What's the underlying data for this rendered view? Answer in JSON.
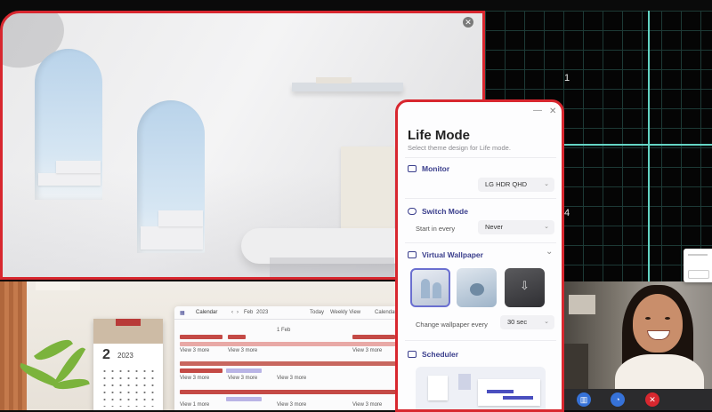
{
  "colors": {
    "accent_red": "#d8272f",
    "panel_accent": "#3a3e8c",
    "grid_line": "#63d4c4"
  },
  "grid": {
    "label_1": "1",
    "label_4": "4"
  },
  "panel": {
    "title": "Life Mode",
    "subtitle": "Select theme design for Life mode.",
    "monitor": {
      "label": "Monitor",
      "icon": "monitor-icon",
      "value": "LG HDR QHD"
    },
    "switch_mode": {
      "label": "Switch Mode",
      "icon": "switch-icon",
      "field_label": "Start in every",
      "value": "Never"
    },
    "virtual_wallpaper": {
      "label": "Virtual Wallpaper",
      "icon": "wallpaper-icon",
      "change_label": "Change wallpaper every",
      "interval": "30 sec"
    },
    "scheduler": {
      "label": "Scheduler",
      "icon": "calendar-icon"
    },
    "minimize_glyph": "—",
    "close_glyph": "✕",
    "collapse_glyph": "⌄"
  },
  "desk_calendar": {
    "day": "2",
    "year": "2023"
  },
  "calendar_app": {
    "title": "Calendar",
    "month": "Feb",
    "year": "2023",
    "view": "Weekly View",
    "today": "Today",
    "date_label": "1 Feb",
    "more_label": "View 3 more",
    "more_label_2": "View 1 more"
  },
  "video_call": {
    "buttons": [
      "chart-icon",
      "chat-icon",
      "hangup-icon"
    ]
  }
}
